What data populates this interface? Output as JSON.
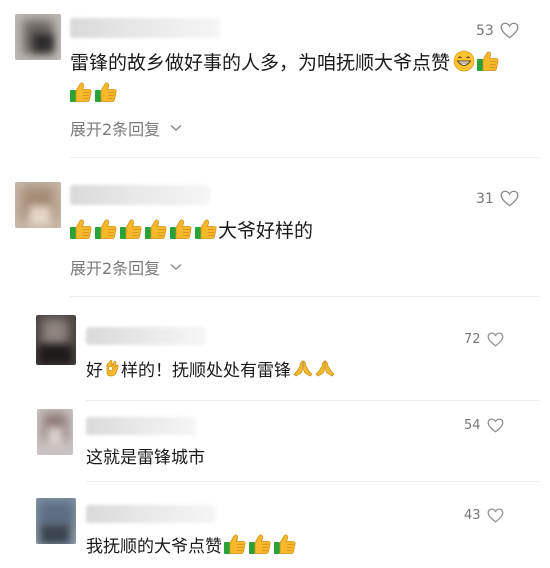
{
  "comments": [
    {
      "likes": "53",
      "text": "雷锋的故乡做好事的人多，为咱抚顺大爷点赞",
      "expand": "展开2条回复"
    },
    {
      "likes": "31",
      "text": "大爷好样的",
      "expand": "展开2条回复"
    },
    {
      "likes": "72",
      "text_a": "好",
      "text_b": "样的！抚顺处处有雷锋"
    },
    {
      "likes": "54",
      "text": "这就是雷锋城市"
    },
    {
      "likes": "43",
      "text": "我抚顺的大爷点赞"
    }
  ],
  "icons": {
    "like": "heart-outline-icon",
    "thumbs_up": "thumbs-up-emoji",
    "grin": "grinning-face-emoji",
    "ok_hand": "ok-hand-emoji",
    "pray": "folded-hands-emoji",
    "expand": "chevron-down-icon"
  },
  "colors": {
    "text": "#1a1a1a",
    "secondary": "#7a7a7a",
    "thumb_yellow": "#f6b92b",
    "cuff_green": "#27a33a"
  }
}
